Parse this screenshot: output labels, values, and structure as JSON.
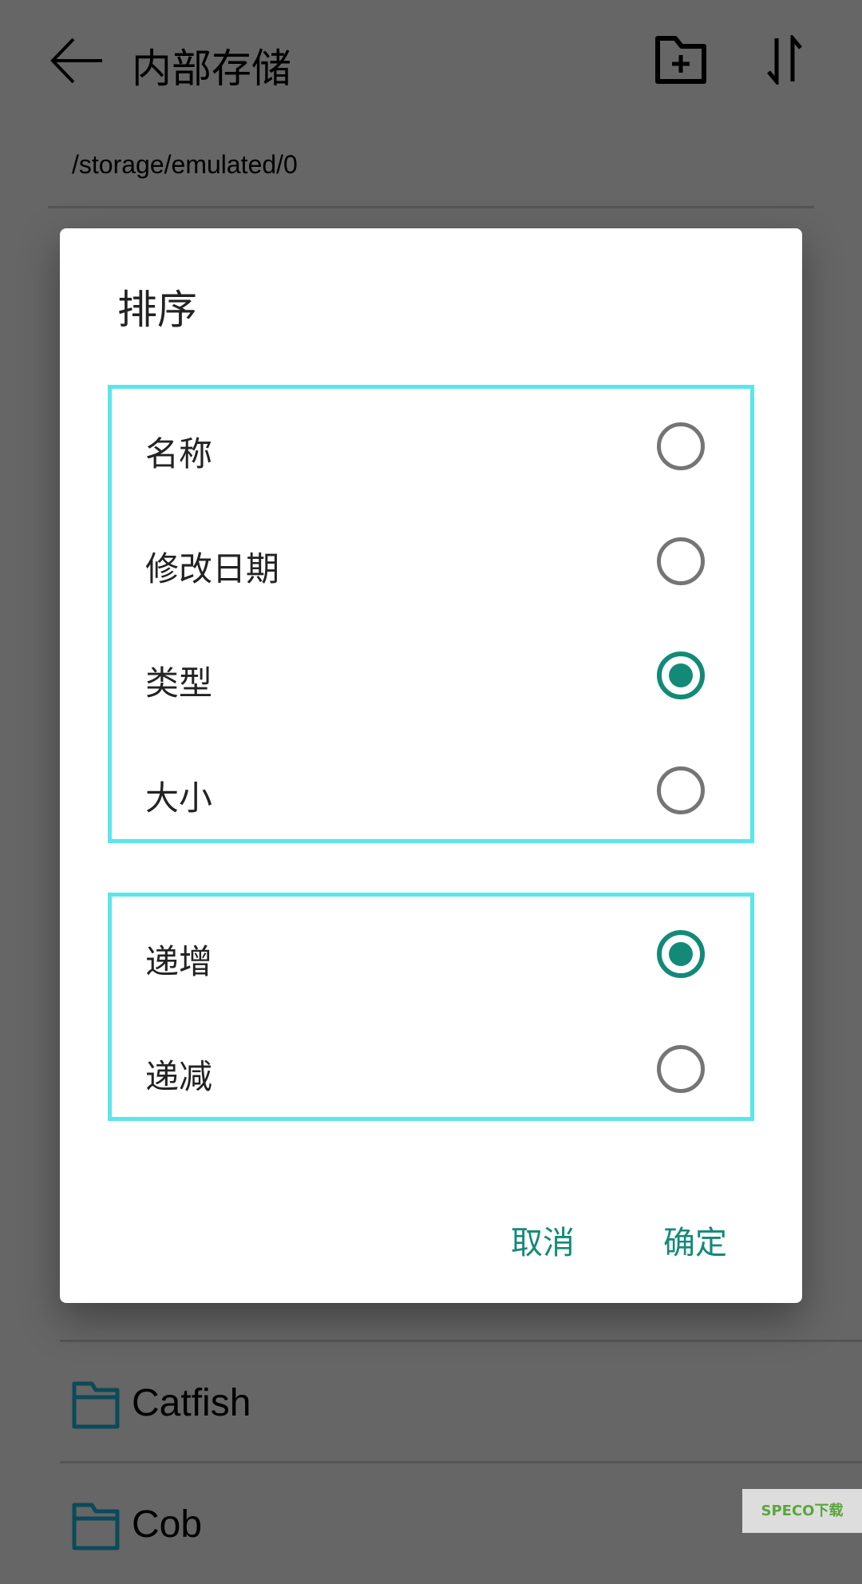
{
  "toolbar": {
    "title": "内部存储",
    "back_icon": "arrow-left-icon",
    "new_folder_icon": "folder-plus-icon",
    "sort_icon": "sort-icon"
  },
  "path": "/storage/emulated/0",
  "files": [
    {
      "name": "Catfish",
      "icon": "folder-icon"
    },
    {
      "name": "Cob",
      "icon": "folder-icon"
    }
  ],
  "dialog": {
    "title": "排序",
    "sort_by": [
      {
        "label": "名称",
        "selected": false
      },
      {
        "label": "修改日期",
        "selected": false
      },
      {
        "label": "类型",
        "selected": true
      },
      {
        "label": "大小",
        "selected": false
      }
    ],
    "order": [
      {
        "label": "递增",
        "selected": true
      },
      {
        "label": "递减",
        "selected": false
      }
    ],
    "cancel": "取消",
    "ok": "确定"
  },
  "watermark": "SPECO下载",
  "colors": {
    "accent": "#138a78",
    "highlight_border": "#5ae6ec"
  }
}
